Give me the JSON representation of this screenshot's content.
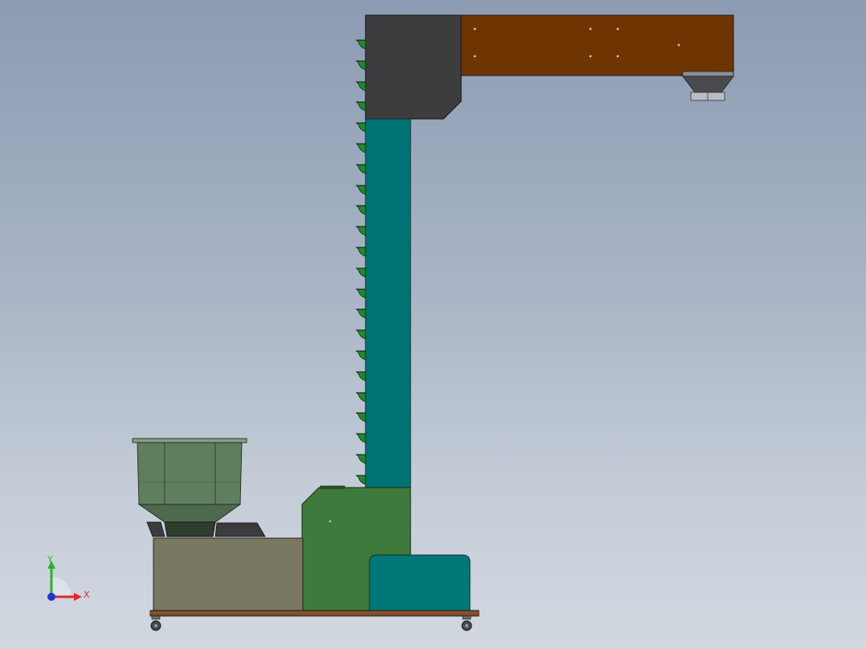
{
  "triad": {
    "x_label": "X",
    "y_label": "Y",
    "x_color": "#e0262b",
    "y_color": "#2fb02f",
    "z_color": "#2433cf"
  },
  "colors": {
    "background_top": "#8c9bb2",
    "background_bottom": "#d2d8e0",
    "head_housing": "#3d3d40",
    "top_conveyor": "#6e3503",
    "elevator_column": "#007474",
    "buckets": "#1f8a2c",
    "boot_section": "#3e7a3c",
    "motor": "#007878",
    "feeder_base": "#7a7860",
    "hopper": "#5e7e5e",
    "frame_rail": "#7a4a2a",
    "discharge_chute": "#55565a"
  },
  "components": [
    {
      "name": "head-housing",
      "label": ""
    },
    {
      "name": "top-horizontal-conveyor",
      "label": ""
    },
    {
      "name": "discharge-chute",
      "label": ""
    },
    {
      "name": "vertical-elevator-column",
      "label": ""
    },
    {
      "name": "bucket-chain",
      "label": ""
    },
    {
      "name": "boot-section",
      "label": ""
    },
    {
      "name": "drive-motor",
      "label": ""
    },
    {
      "name": "vibratory-feeder-base",
      "label": ""
    },
    {
      "name": "feed-hopper",
      "label": ""
    },
    {
      "name": "base-frame",
      "label": ""
    },
    {
      "name": "caster-wheels",
      "label": ""
    }
  ]
}
